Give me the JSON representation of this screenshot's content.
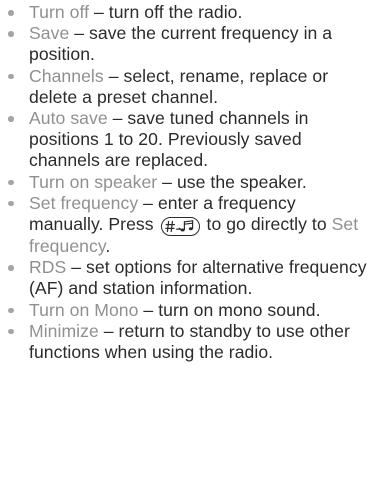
{
  "options": [
    {
      "term": "Turn off",
      "sep": " – ",
      "desc": "turn off the radio."
    },
    {
      "term": "Save",
      "sep": " – ",
      "desc": "save the current frequency in a position."
    },
    {
      "term": "Channels",
      "sep": " – ",
      "desc": "select, rename, replace or delete a preset channel."
    },
    {
      "term": "Auto save",
      "sep": " – ",
      "desc": "save tuned channels in positions 1 to 20. Previously saved channels are replaced."
    },
    {
      "term": "Turn on speaker",
      "sep": " – ",
      "desc": "use the speaker."
    },
    {
      "term": "Set frequency",
      "sep": " – ",
      "desc_before": "enter a frequency manually. Press",
      "key_icon": "hash-music-key-icon",
      "desc_middle": "to go directly to",
      "ref_term": "Set frequency",
      "desc_after": "."
    },
    {
      "term": "RDS",
      "sep": " – ",
      "desc": "set options for alternative frequency (AF) and station information."
    },
    {
      "term": "Turn on Mono",
      "sep": " – ",
      "desc": "turn on mono sound."
    },
    {
      "term": "Minimize",
      "sep": " – ",
      "desc": "return to standby to use other functions when using the radio."
    }
  ]
}
